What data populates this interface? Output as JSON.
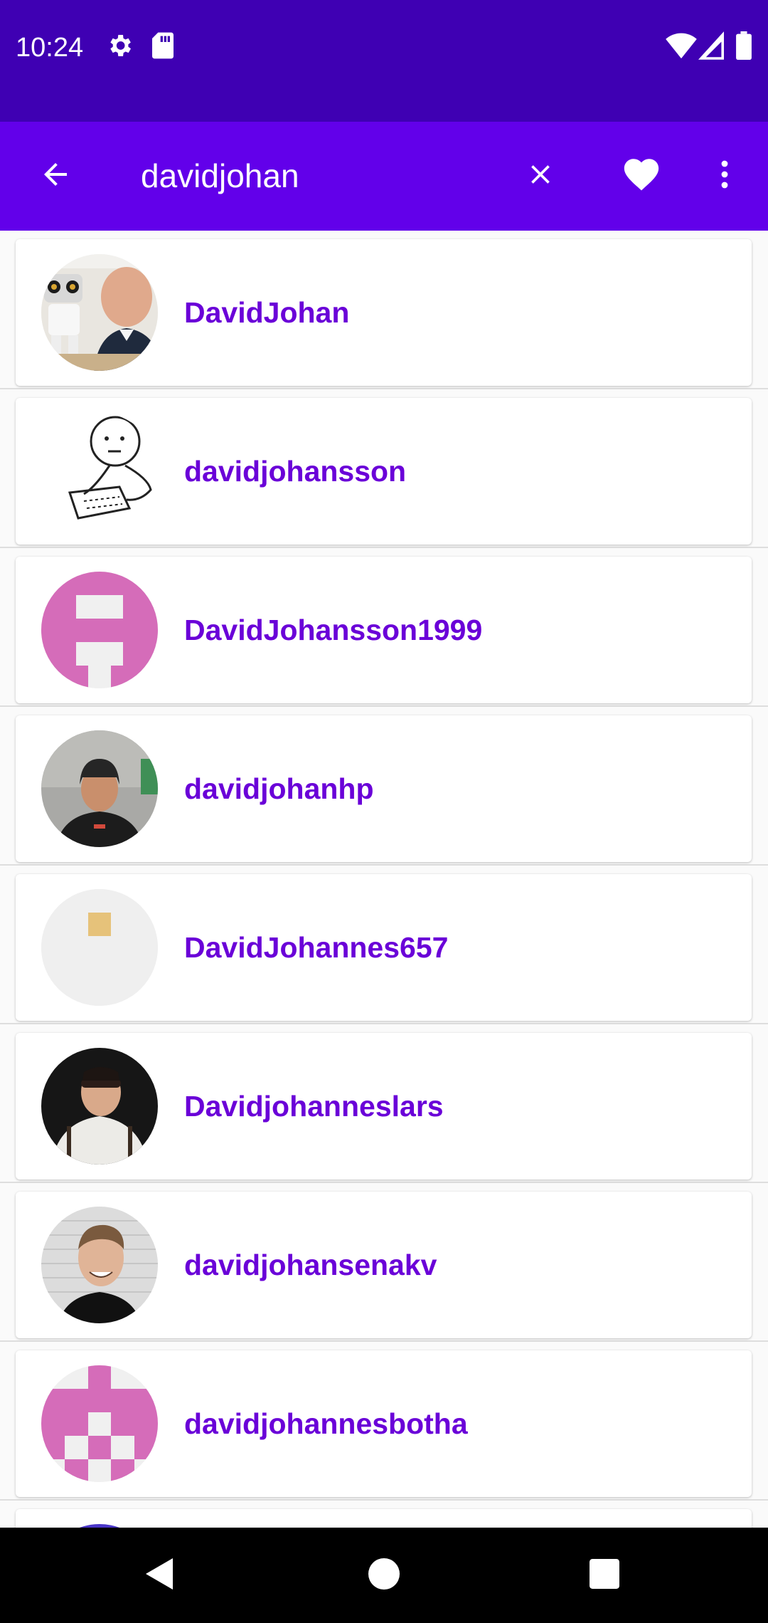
{
  "status_bar": {
    "time": "10:24",
    "icons": [
      "settings-icon",
      "sd-card-icon",
      "wifi-icon",
      "signal-icon",
      "battery-icon"
    ]
  },
  "toolbar": {
    "search_value": "davidjohan",
    "icons": [
      "back-arrow-icon",
      "clear-icon",
      "favorite-heart-icon",
      "more-vert-icon"
    ]
  },
  "results": [
    {
      "username": "DavidJohan"
    },
    {
      "username": "davidjohansson"
    },
    {
      "username": "DavidJohansson1999"
    },
    {
      "username": "davidjohanhp"
    },
    {
      "username": "DavidJohannes657"
    },
    {
      "username": "Davidjohanneslars"
    },
    {
      "username": "davidjohansenakv"
    },
    {
      "username": "davidjohannesbotha"
    }
  ],
  "nav_bar": {
    "icons": [
      "back-triangle-icon",
      "home-circle-icon",
      "recents-square-icon"
    ]
  },
  "colors": {
    "status_bar": "#3f00b3",
    "app_bar": "#6200ea",
    "username_text": "#6a00d8",
    "identicon_pink": "#d56cb9"
  }
}
